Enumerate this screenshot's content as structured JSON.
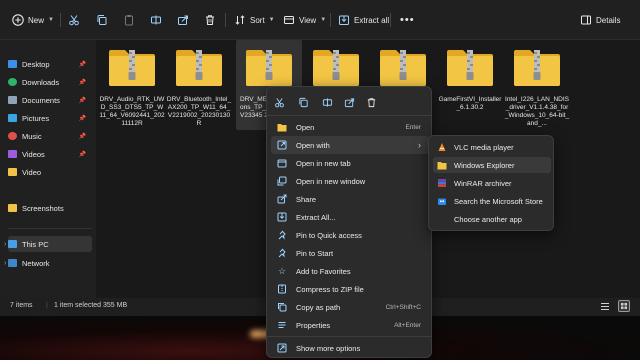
{
  "toolbar": {
    "new_label": "New",
    "sort_label": "Sort",
    "view_label": "View",
    "extract_all_label": "Extract all",
    "details_label": "Details"
  },
  "sidebar": {
    "quick_access": [
      {
        "label": "Desktop",
        "icon": "desktop-icon"
      },
      {
        "label": "Downloads",
        "icon": "downloads-icon"
      },
      {
        "label": "Documents",
        "icon": "documents-icon"
      },
      {
        "label": "Pictures",
        "icon": "pictures-icon"
      },
      {
        "label": "Music",
        "icon": "music-icon"
      },
      {
        "label": "Videos",
        "icon": "videos-icon"
      },
      {
        "label": "Video",
        "icon": "folder-icon"
      },
      {
        "label": "Screenshots",
        "icon": "folder-icon"
      }
    ],
    "this_pc_label": "This PC",
    "network_label": "Network"
  },
  "files": [
    {
      "name": "DRV_Audio_RTK_UWD_SS3_DTS5_TP_W11_64_V6092441_20211112R"
    },
    {
      "name": "DRV_Bluetooth_Intel_AX200_TP_W11_64_V2219002_20230130R"
    },
    {
      "name": "DRV_ME ons_TP_ V23345 20",
      "selected": true
    },
    {
      "name": ""
    },
    {
      "name": ""
    },
    {
      "name": "GameFirstVI_Installer_6.1.30.2"
    },
    {
      "name": "Intel_I226_LAN_NDIS_driver_V1.1.4.38_for_Windows_10_64-bit_and_..."
    }
  ],
  "status": {
    "items_count": "7 items",
    "selection": "1 item selected  355 MB"
  },
  "context_menu": {
    "items": [
      {
        "label": "Open",
        "shortcut": "Enter",
        "icon": "open-icon"
      },
      {
        "label": "Open with",
        "shortcut": "",
        "icon": "open-with-icon",
        "submenu": true
      },
      {
        "label": "Open in new tab",
        "shortcut": "",
        "icon": "new-tab-icon"
      },
      {
        "label": "Open in new window",
        "shortcut": "",
        "icon": "new-window-icon"
      },
      {
        "label": "Share",
        "shortcut": "",
        "icon": "share-icon"
      },
      {
        "label": "Extract All...",
        "shortcut": "",
        "icon": "extract-icon"
      },
      {
        "label": "Pin to Quick access",
        "shortcut": "",
        "icon": "pin-icon"
      },
      {
        "label": "Pin to Start",
        "shortcut": "",
        "icon": "pin-start-icon"
      },
      {
        "label": "Add to Favorites",
        "shortcut": "",
        "icon": "star-icon"
      },
      {
        "label": "Compress to ZIP file",
        "shortcut": "",
        "icon": "zip-icon"
      },
      {
        "label": "Copy as path",
        "shortcut": "Ctrl+Shift+C",
        "icon": "copy-path-icon"
      },
      {
        "label": "Properties",
        "shortcut": "Alt+Enter",
        "icon": "properties-icon"
      },
      {
        "label": "Show more options",
        "shortcut": "",
        "icon": "more-options-icon"
      }
    ]
  },
  "open_with_menu": {
    "items": [
      {
        "label": "VLC media player",
        "icon": "vlc-icon"
      },
      {
        "label": "Windows Explorer",
        "icon": "folder-icon"
      },
      {
        "label": "WinRAR archiver",
        "icon": "winrar-icon"
      },
      {
        "label": "Search the Microsoft Store",
        "icon": "store-icon"
      },
      {
        "label": "Choose another app",
        "icon": ""
      }
    ]
  },
  "colors": {
    "folder": "#f3c545",
    "folder_dark": "#e2a823",
    "accent": "#4cc2ff"
  }
}
